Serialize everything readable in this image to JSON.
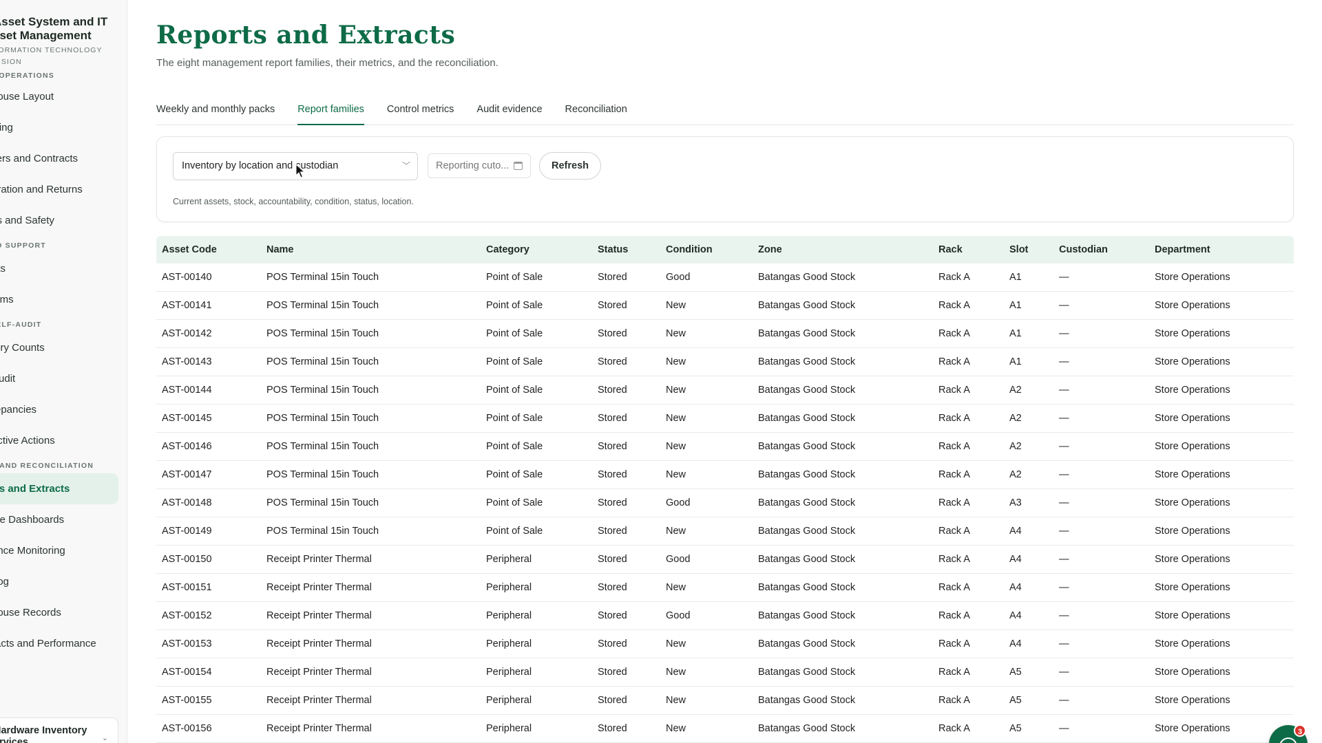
{
  "sidebar": {
    "brand_title_1": "Asset System and IT",
    "brand_title_2": "sset Management",
    "brand_sub_1": "FORMATION TECHNOLOGY",
    "brand_sub_2": "VISION",
    "sections": [
      {
        "label": "E OPERATIONS",
        "items": [
          "house Layout",
          "iving",
          "liers and Contracts",
          "aration and Returns",
          "ss and Safety"
        ]
      },
      {
        "label": "ND SUPPORT",
        "items": [
          "ets",
          "lems"
        ]
      },
      {
        "label": "SELF-AUDIT",
        "items": [
          "tory Counts",
          "Audit",
          "repancies",
          "ective Actions"
        ]
      },
      {
        "label": "G AND RECONCILIATION",
        "items": [
          "rts and Extracts",
          "ule Dashboards",
          "ance Monitoring",
          "Log",
          "house Records",
          "racts and Performance"
        ]
      }
    ],
    "profile_name_1": "Hardware Inventory",
    "profile_name_2": "ervices"
  },
  "page": {
    "title": "Reports and Extracts",
    "subtitle": "The eight management report families, their metrics, and the reconciliation."
  },
  "tabs": [
    "Weekly and monthly packs",
    "Report families",
    "Control metrics",
    "Audit evidence",
    "Reconciliation"
  ],
  "active_tab": "Report families",
  "filters": {
    "report_family": "Inventory by location and custodian",
    "cutoff_placeholder": "Reporting cuto...",
    "refresh_label": "Refresh",
    "hint": "Current assets, stock, accountability, condition, status, location."
  },
  "table": {
    "columns": [
      "Asset Code",
      "Name",
      "Category",
      "Status",
      "Condition",
      "Zone",
      "Rack",
      "Slot",
      "Custodian",
      "Department"
    ],
    "rows": [
      [
        "AST-00140",
        "POS Terminal 15in Touch",
        "Point of Sale",
        "Stored",
        "Good",
        "Batangas Good Stock",
        "Rack A",
        "A1",
        "—",
        "Store Operations"
      ],
      [
        "AST-00141",
        "POS Terminal 15in Touch",
        "Point of Sale",
        "Stored",
        "New",
        "Batangas Good Stock",
        "Rack A",
        "A1",
        "—",
        "Store Operations"
      ],
      [
        "AST-00142",
        "POS Terminal 15in Touch",
        "Point of Sale",
        "Stored",
        "New",
        "Batangas Good Stock",
        "Rack A",
        "A1",
        "—",
        "Store Operations"
      ],
      [
        "AST-00143",
        "POS Terminal 15in Touch",
        "Point of Sale",
        "Stored",
        "New",
        "Batangas Good Stock",
        "Rack A",
        "A1",
        "—",
        "Store Operations"
      ],
      [
        "AST-00144",
        "POS Terminal 15in Touch",
        "Point of Sale",
        "Stored",
        "New",
        "Batangas Good Stock",
        "Rack A",
        "A2",
        "—",
        "Store Operations"
      ],
      [
        "AST-00145",
        "POS Terminal 15in Touch",
        "Point of Sale",
        "Stored",
        "New",
        "Batangas Good Stock",
        "Rack A",
        "A2",
        "—",
        "Store Operations"
      ],
      [
        "AST-00146",
        "POS Terminal 15in Touch",
        "Point of Sale",
        "Stored",
        "New",
        "Batangas Good Stock",
        "Rack A",
        "A2",
        "—",
        "Store Operations"
      ],
      [
        "AST-00147",
        "POS Terminal 15in Touch",
        "Point of Sale",
        "Stored",
        "New",
        "Batangas Good Stock",
        "Rack A",
        "A2",
        "—",
        "Store Operations"
      ],
      [
        "AST-00148",
        "POS Terminal 15in Touch",
        "Point of Sale",
        "Stored",
        "Good",
        "Batangas Good Stock",
        "Rack A",
        "A3",
        "—",
        "Store Operations"
      ],
      [
        "AST-00149",
        "POS Terminal 15in Touch",
        "Point of Sale",
        "Stored",
        "New",
        "Batangas Good Stock",
        "Rack A",
        "A4",
        "—",
        "Store Operations"
      ],
      [
        "AST-00150",
        "Receipt Printer Thermal",
        "Peripheral",
        "Stored",
        "Good",
        "Batangas Good Stock",
        "Rack A",
        "A4",
        "—",
        "Store Operations"
      ],
      [
        "AST-00151",
        "Receipt Printer Thermal",
        "Peripheral",
        "Stored",
        "New",
        "Batangas Good Stock",
        "Rack A",
        "A4",
        "—",
        "Store Operations"
      ],
      [
        "AST-00152",
        "Receipt Printer Thermal",
        "Peripheral",
        "Stored",
        "Good",
        "Batangas Good Stock",
        "Rack A",
        "A4",
        "—",
        "Store Operations"
      ],
      [
        "AST-00153",
        "Receipt Printer Thermal",
        "Peripheral",
        "Stored",
        "New",
        "Batangas Good Stock",
        "Rack A",
        "A4",
        "—",
        "Store Operations"
      ],
      [
        "AST-00154",
        "Receipt Printer Thermal",
        "Peripheral",
        "Stored",
        "New",
        "Batangas Good Stock",
        "Rack A",
        "A5",
        "—",
        "Store Operations"
      ],
      [
        "AST-00155",
        "Receipt Printer Thermal",
        "Peripheral",
        "Stored",
        "New",
        "Batangas Good Stock",
        "Rack A",
        "A5",
        "—",
        "Store Operations"
      ],
      [
        "AST-00156",
        "Receipt Printer Thermal",
        "Peripheral",
        "Stored",
        "New",
        "Batangas Good Stock",
        "Rack A",
        "A5",
        "—",
        "Store Operations"
      ]
    ]
  },
  "chat_badge": "3",
  "colors": {
    "accent": "#0d6b47",
    "header_bg": "#eaf4ef",
    "active_nav_bg": "#e3f1ea",
    "badge": "#d9342b"
  }
}
